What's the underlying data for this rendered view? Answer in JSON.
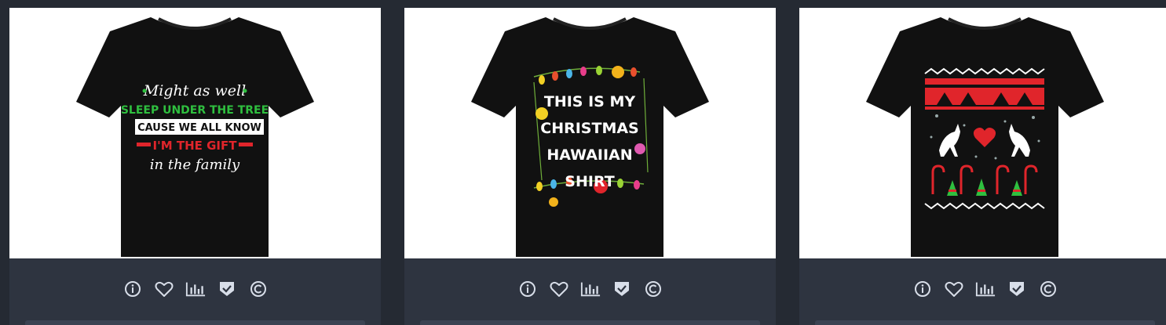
{
  "colors": {
    "background": "#252a33",
    "card_footer": "#2e3440",
    "icon": "#d8dee9",
    "shirt": "#111111",
    "green": "#2fbf3f",
    "red": "#e0252b"
  },
  "action_icons": [
    "info-icon",
    "heart-icon",
    "bar-chart-icon",
    "shield-check-icon",
    "copyright-icon"
  ],
  "products": [
    {
      "design_lines": [
        "Might as well",
        "SLEEP UNDER THE TREE",
        "CAUSE WE ALL KNOW",
        "I'M THE GIFT",
        "in the family"
      ]
    },
    {
      "design_lines": [
        "THIS IS MY",
        "CHRISTMAS",
        "HAWAIIAN",
        "SHIRT"
      ]
    },
    {
      "design_lines": []
    }
  ]
}
